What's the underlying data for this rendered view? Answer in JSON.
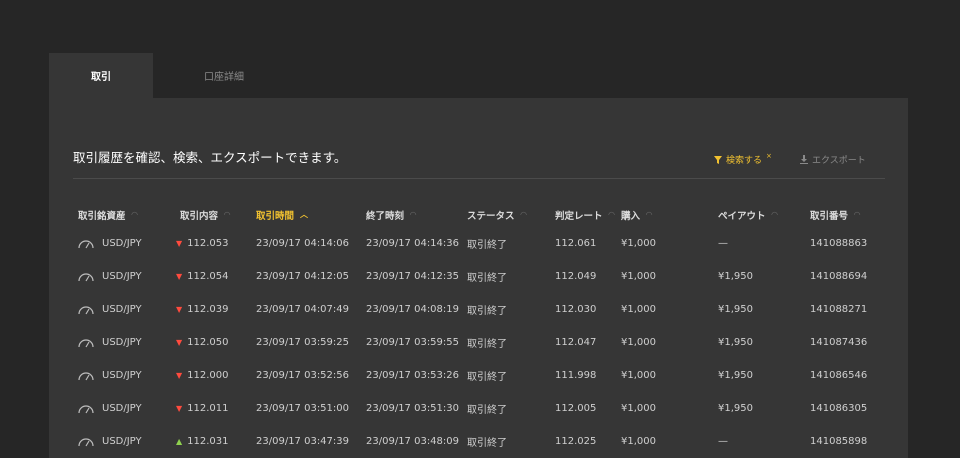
{
  "tabs": [
    {
      "label": "取引"
    },
    {
      "label": "口座詳細"
    }
  ],
  "intro": "取引履歴を確認、検索、エクスポートできます。",
  "toolbar": {
    "search_label": "検索する",
    "search_sup": "×",
    "export_label": "エクスポート"
  },
  "columns": [
    {
      "label": "取引銘資産"
    },
    {
      "label": "取引内容"
    },
    {
      "label": "取引時間"
    },
    {
      "label": "終了時刻"
    },
    {
      "label": "ステータス"
    },
    {
      "label": "判定レート"
    },
    {
      "label": "購入"
    },
    {
      "label": "ペイアウト"
    },
    {
      "label": "取引番号"
    }
  ],
  "icons": {
    "gauge": "gauge-icon",
    "arrow_down": "down-arrow-icon",
    "arrow_up": "up-arrow-icon",
    "filter": "filter-icon",
    "download": "download-icon",
    "sort": "sort-icon",
    "sort_up": "sort-ascending-icon"
  },
  "colors": {
    "accent": "#f2c230",
    "down": "#ff4b3e",
    "up": "#8fd14f"
  },
  "rows": [
    {
      "asset": "USD/JPY",
      "direction": "down",
      "rate": "112.053",
      "start": "23/09/17 04:14:06",
      "end": "23/09/17 04:14:36",
      "status": "取引終了",
      "judge": "112.061",
      "buy": "¥1,000",
      "payout": "—",
      "id": "141088863"
    },
    {
      "asset": "USD/JPY",
      "direction": "down",
      "rate": "112.054",
      "start": "23/09/17 04:12:05",
      "end": "23/09/17 04:12:35",
      "status": "取引終了",
      "judge": "112.049",
      "buy": "¥1,000",
      "payout": "¥1,950",
      "id": "141088694"
    },
    {
      "asset": "USD/JPY",
      "direction": "down",
      "rate": "112.039",
      "start": "23/09/17 04:07:49",
      "end": "23/09/17 04:08:19",
      "status": "取引終了",
      "judge": "112.030",
      "buy": "¥1,000",
      "payout": "¥1,950",
      "id": "141088271"
    },
    {
      "asset": "USD/JPY",
      "direction": "down",
      "rate": "112.050",
      "start": "23/09/17 03:59:25",
      "end": "23/09/17 03:59:55",
      "status": "取引終了",
      "judge": "112.047",
      "buy": "¥1,000",
      "payout": "¥1,950",
      "id": "141087436"
    },
    {
      "asset": "USD/JPY",
      "direction": "down",
      "rate": "112.000",
      "start": "23/09/17 03:52:56",
      "end": "23/09/17 03:53:26",
      "status": "取引終了",
      "judge": "111.998",
      "buy": "¥1,000",
      "payout": "¥1,950",
      "id": "141086546"
    },
    {
      "asset": "USD/JPY",
      "direction": "down",
      "rate": "112.011",
      "start": "23/09/17 03:51:00",
      "end": "23/09/17 03:51:30",
      "status": "取引終了",
      "judge": "112.005",
      "buy": "¥1,000",
      "payout": "¥1,950",
      "id": "141086305"
    },
    {
      "asset": "USD/JPY",
      "direction": "up",
      "rate": "112.031",
      "start": "23/09/17 03:47:39",
      "end": "23/09/17 03:48:09",
      "status": "取引終了",
      "judge": "112.025",
      "buy": "¥1,000",
      "payout": "—",
      "id": "141085898"
    }
  ]
}
